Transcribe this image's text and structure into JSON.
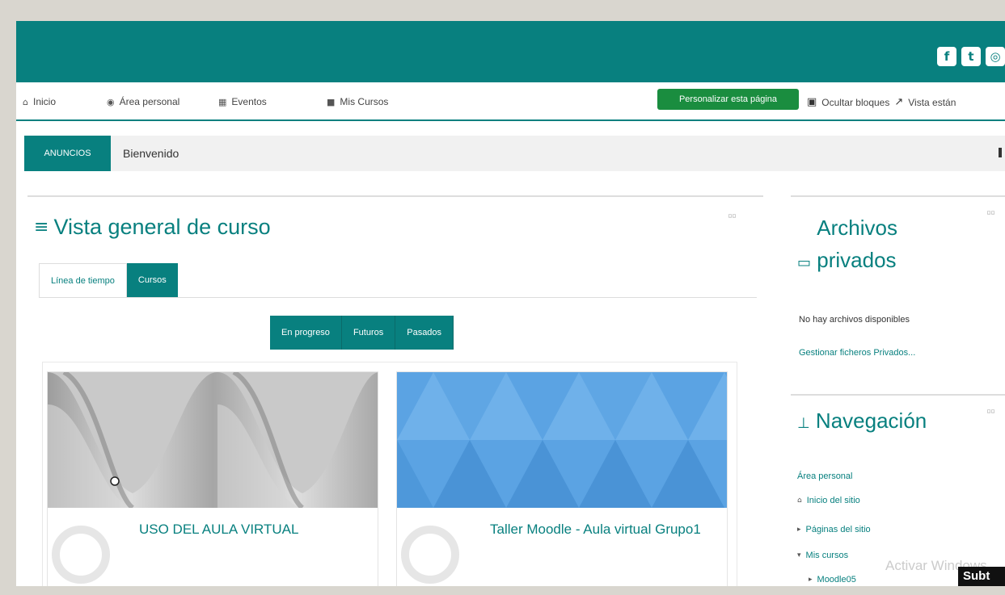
{
  "social": {
    "icons": [
      "facebook-icon",
      "twitter-icon",
      "instagram-icon"
    ],
    "glyphs": [
      "f",
      "t",
      "◎"
    ]
  },
  "nav": {
    "items": [
      {
        "icon": "home-icon",
        "glyph": "⌂",
        "label": "Inicio"
      },
      {
        "icon": "dashboard-icon",
        "glyph": "◉",
        "label": "Área personal"
      },
      {
        "icon": "calendar-icon",
        "glyph": "▦",
        "label": "Eventos"
      },
      {
        "icon": "briefcase-icon",
        "glyph": "■",
        "label": "Mis Cursos"
      }
    ],
    "personalize_label": "Personalizar esta página",
    "hide_blocks_label": "Ocultar bloques",
    "standard_view_label": "Vista están"
  },
  "announcements": {
    "tag": "ANUNCIOS",
    "text": "Bienvenido"
  },
  "overview": {
    "title": "Vista general de curso",
    "tabs": [
      {
        "label": "Línea de tiempo",
        "active": false
      },
      {
        "label": "Cursos",
        "active": true
      }
    ],
    "filters": [
      "En progreso",
      "Futuros",
      "Pasados"
    ],
    "courses": [
      {
        "title": "USO DEL AULA VIRTUAL",
        "image": "grey-wave-pattern"
      },
      {
        "title": "Taller Moodle - Aula virtual Grupo1",
        "image": "blue-triangle-pattern"
      }
    ]
  },
  "private_files": {
    "title": "Archivos privados",
    "empty_text": "No hay archivos disponibles",
    "manage_link": "Gestionar ficheros Privados..."
  },
  "navigation": {
    "title": "Navegación",
    "items": [
      {
        "label": "Área personal",
        "glyph": ""
      },
      {
        "label": "Inicio del sitio",
        "glyph": "⌂"
      },
      {
        "label": "Páginas del sitio",
        "glyph": "▸"
      },
      {
        "label": "Mis cursos",
        "glyph": "▾"
      },
      {
        "label": "Moodle05",
        "glyph": "▸"
      }
    ]
  },
  "overlay": {
    "watermark": "Activar Windows",
    "subtitle_badge": "Subt"
  },
  "colors": {
    "primary": "#08807f",
    "success": "#1a8d3f"
  }
}
